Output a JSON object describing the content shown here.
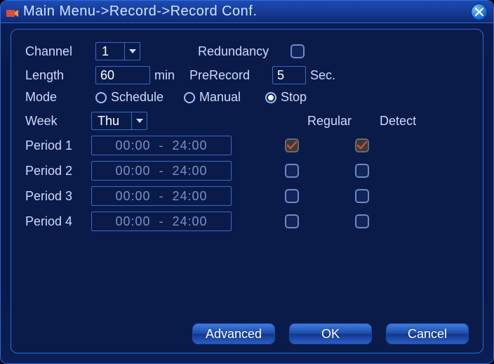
{
  "title": "Main Menu->Record->Record Conf.",
  "labels": {
    "channel": "Channel",
    "length": "Length",
    "min": "min",
    "redundancy": "Redundancy",
    "prerecord": "PreRecord",
    "sec": "Sec.",
    "mode": "Mode",
    "schedule": "Schedule",
    "manual": "Manual",
    "stop": "Stop",
    "week": "Week",
    "regular": "Regular",
    "detect": "Detect",
    "period1": "Period 1",
    "period2": "Period 2",
    "period3": "Period 3",
    "period4": "Period 4"
  },
  "values": {
    "channel": "1",
    "length": "60",
    "prerecord": "5",
    "week": "Thu",
    "redundancy_checked": false,
    "mode_selected": "stop"
  },
  "periods": [
    {
      "label_key": "period1",
      "start": "00:00",
      "end": "24:00",
      "regular": true,
      "detect": true
    },
    {
      "label_key": "period2",
      "start": "00:00",
      "end": "24:00",
      "regular": false,
      "detect": false
    },
    {
      "label_key": "period3",
      "start": "00:00",
      "end": "24:00",
      "regular": false,
      "detect": false
    },
    {
      "label_key": "period4",
      "start": "00:00",
      "end": "24:00",
      "regular": false,
      "detect": false
    }
  ],
  "buttons": {
    "advanced": "Advanced",
    "ok": "OK",
    "cancel": "Cancel"
  }
}
